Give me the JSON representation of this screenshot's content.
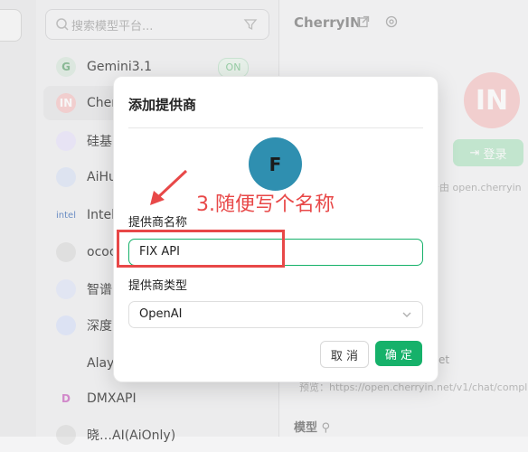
{
  "search": {
    "placeholder": "搜索模型平台..."
  },
  "providers": [
    {
      "name": "Gemini3.1",
      "logo": "G",
      "logo_bg": "#e3efe6",
      "logo_fg": "#8bbd97"
    },
    {
      "name": "Cher",
      "logo": "IN",
      "logo_bg": "#f9d4d4",
      "logo_fg": "#ffffff"
    },
    {
      "name": "硅基",
      "logo": "",
      "logo_bg": "#eeeafc",
      "logo_fg": "#8f7ad8"
    },
    {
      "name": "AiHu",
      "logo": "",
      "logo_bg": "#e4eaf8",
      "logo_fg": "#5b7cc7"
    },
    {
      "name": "Intel",
      "logo": "intel",
      "logo_bg": "transparent",
      "logo_fg": "#6a8fc9"
    },
    {
      "name": "ococ",
      "logo": "",
      "logo_bg": "#e6e6e6",
      "logo_fg": "#777777"
    },
    {
      "name": "智谱",
      "logo": "",
      "logo_bg": "#e8ecfa",
      "logo_fg": "#6d7fd6"
    },
    {
      "name": "深度",
      "logo": "",
      "logo_bg": "#e3e9fb",
      "logo_fg": "#5f79d9"
    },
    {
      "name": "Alay",
      "logo": "",
      "logo_bg": "transparent",
      "logo_fg": "#c79a5b"
    },
    {
      "name": "DMXAPI",
      "logo": "D",
      "logo_bg": "transparent",
      "logo_fg": "#d78ad0"
    },
    {
      "name": "晓…AI(AiOnly)",
      "logo": "",
      "logo_bg": "#e6e6e6",
      "logo_fg": "#999999"
    }
  ],
  "on_badge": "ON",
  "detail": {
    "title": "CherryIN",
    "logo": "IN",
    "login_label": "登录",
    "service_text": "服务由 open.cherryin",
    "api_hint_prefix": "et",
    "preview_text": "预览：https://open.cherryin.net/v1/chat/completi",
    "models_title": "模型"
  },
  "modal": {
    "title": "添加提供商",
    "avatar_letter": "F",
    "avatar_color": "#2f8fb0",
    "name_label": "提供商名称",
    "name_value": "FIX API",
    "type_label": "提供商类型",
    "type_value": "OpenAI",
    "cancel_label": "取 消",
    "ok_label": "确 定"
  },
  "annotation": {
    "text": "3.随便写个名称",
    "color": "#e84848"
  },
  "colors": {
    "accent": "#16b16a"
  }
}
